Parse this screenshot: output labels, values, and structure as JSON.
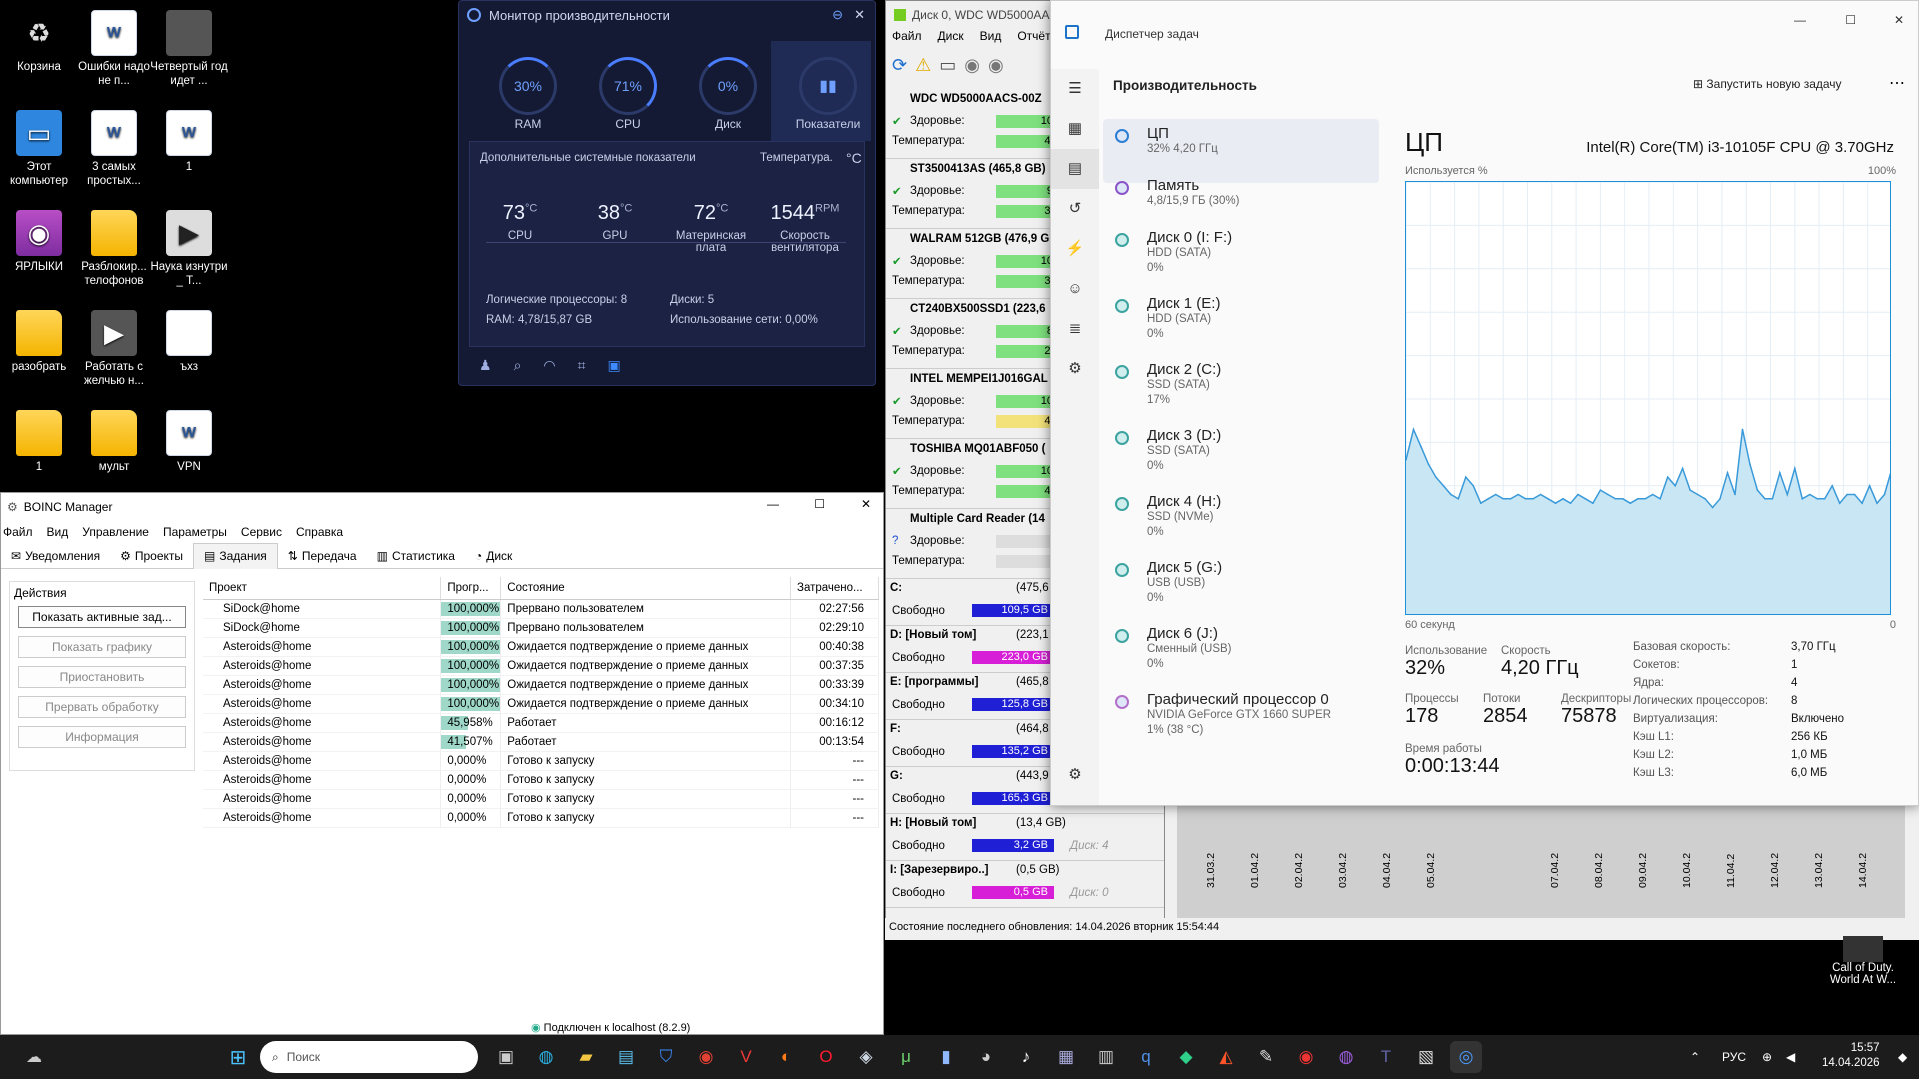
{
  "desktop": {
    "icons": [
      "Корзина",
      "Ошибки надо не п...",
      "Четвертый год идет ...",
      "Этот компьютер",
      "3 самых простых...",
      "1",
      "ЯРЛЫКИ",
      "Разблокир... телофонов",
      "Наука изнутри _ Т...",
      "разобрать",
      "Работать с желчью н...",
      "ъхз",
      "1",
      "мульт",
      "VPN"
    ],
    "callofduty": "Call of Duty. World At W..."
  },
  "perfmon": {
    "title": "Монитор производительности",
    "gauges": [
      {
        "value": "30%",
        "label": "RAM"
      },
      {
        "value": "71%",
        "label": "CPU"
      },
      {
        "value": "0%",
        "label": "Диск"
      },
      {
        "value": "",
        "label": "Показатели"
      }
    ],
    "panel_title": "Дополнительные системные показатели",
    "temp_label": "Температура.",
    "temp_unit": "°C",
    "metrics": [
      {
        "v": "73",
        "u": "°C",
        "l": "CPU"
      },
      {
        "v": "38",
        "u": "°C",
        "l": "GPU"
      },
      {
        "v": "72",
        "u": "°C",
        "l": "Материнская плата"
      },
      {
        "v": "1544",
        "u": "RPM",
        "l": "Скорость вентилятора"
      }
    ],
    "info": [
      "Логические процессоры: 8",
      "Диски: 5",
      "RAM: 4,78/15,87 GB",
      "Использование сети: 0,00%"
    ]
  },
  "diskwin": {
    "title": "Диск 0, WDC WD5000AA",
    "menu": [
      "Файл",
      "Диск",
      "Вид",
      "Отчёт"
    ],
    "health_label": "Здоровье:",
    "temp_label": "Температура:",
    "disks": [
      {
        "name": "WDC WD5000AACS-00Z",
        "health": "100 %",
        "temp": "40 °C"
      },
      {
        "name": "ST3500413AS (465,8 GB)",
        "health": "97 %",
        "temp": "39 °C"
      },
      {
        "name": "WALRAM 512GB (476,9 G",
        "health": "100 %",
        "temp": "30 °C"
      },
      {
        "name": "CT240BX500SSD1 (223,6",
        "health": "86 %",
        "temp": "28 °C"
      },
      {
        "name": "INTEL MEMPEI1J016GAL",
        "health": "100 %",
        "temp": "49 °C"
      },
      {
        "name": "TOSHIBA MQ01ABF050 (",
        "health": "100 %",
        "temp": "41 °C"
      },
      {
        "name": "Multiple Card Reader (14",
        "health": "?",
        "temp": "?"
      }
    ],
    "free_label": "Свободно",
    "vols": [
      {
        "n": "C:",
        "sz": "(475,6",
        "f": "109,5 GB",
        "c": "#1f1fd6"
      },
      {
        "n": "D: [Новый том]",
        "sz": "(223,1",
        "f": "223,0 GB",
        "c": "#d61fd6"
      },
      {
        "n": "E: [программы]",
        "sz": "(465,8",
        "f": "125,8 GB",
        "c": "#1f1fd6"
      },
      {
        "n": "F:",
        "sz": "(464,8",
        "f": "135,2 GB",
        "c": "#1f1fd6"
      },
      {
        "n": "G:",
        "sz": "(443,9",
        "f": "165,3 GB",
        "c": "#1f1fd6",
        "d": "Диск: 5"
      },
      {
        "n": "H: [Новый том]",
        "sz": "(13,4 GB)",
        "f": "3,2 GB",
        "c": "#1f1fd6",
        "d": "Диск: 4"
      },
      {
        "n": "I: [Зарезервиро..]",
        "sz": "(0,5 GB)",
        "f": "0,5 GB",
        "c": "#d61fd6",
        "d": "Диск: 0"
      }
    ],
    "status": "Состояние последнего обновления: 14.04.2026 вторник 15:54:44",
    "dates": [
      "31.03.2",
      "01.04.2",
      "02.04.2",
      "03.04.2",
      "04.04.2",
      "05.04.2",
      "07.04.2",
      "08.04.2",
      "09.04.2",
      "10.04.2",
      "11.04.2",
      "12.04.2",
      "13.04.2",
      "14.04.2"
    ]
  },
  "taskmgr": {
    "title": "Диспетчер задач",
    "section": "Производительность",
    "new_task": "Запустить новую задачу",
    "devices": [
      {
        "n": "ЦП",
        "s1": "32% 4,20 ГГц",
        "s2": "",
        "sel": true,
        "c": "#2a7fd4"
      },
      {
        "n": "Память",
        "s1": "4,8/15,9 ГБ (30%)",
        "s2": "",
        "c": "#8a55c8"
      },
      {
        "n": "Диск 0 (I: F:)",
        "s1": "HDD (SATA)",
        "s2": "0%"
      },
      {
        "n": "Диск 1 (E:)",
        "s1": "HDD (SATA)",
        "s2": "0%"
      },
      {
        "n": "Диск 2 (C:)",
        "s1": "SSD (SATA)",
        "s2": "17%"
      },
      {
        "n": "Диск 3 (D:)",
        "s1": "SSD (SATA)",
        "s2": "0%"
      },
      {
        "n": "Диск 4 (H:)",
        "s1": "SSD (NVMe)",
        "s2": "0%"
      },
      {
        "n": "Диск 5 (G:)",
        "s1": "USB (USB)",
        "s2": "0%"
      },
      {
        "n": "Диск 6 (J:)",
        "s1": "Сменный (USB)",
        "s2": "0%"
      },
      {
        "n": "Графический процессор 0",
        "s1": "NVIDIA GeForce GTX 1660 SUPER",
        "s2": "1% (38 °C)",
        "c": "#b36fc9"
      }
    ],
    "cpu_title": "ЦП",
    "cpu_model": "Intel(R) Core(TM) i3-10105F CPU @ 3.70GHz",
    "usage_pct": "Используется %",
    "pct100": "100%",
    "sec60": "60 секунд",
    "zero": "0",
    "stats": [
      {
        "l": "Использование",
        "v": "32%"
      },
      {
        "l": "Скорость",
        "v": "4,20 ГГц"
      },
      {
        "l": "Процессы",
        "v": "178"
      },
      {
        "l": "Потоки",
        "v": "2854"
      },
      {
        "l": "Дескрипторы",
        "v": "75878"
      },
      {
        "l": "Время работы",
        "v": "0:00:13:44"
      }
    ],
    "specs": [
      [
        "Базовая скорость:",
        "3,70 ГГц"
      ],
      [
        "Сокетов:",
        "1"
      ],
      [
        "Ядра:",
        "4"
      ],
      [
        "Логических процессоров:",
        "8"
      ],
      [
        "Виртуализация:",
        "Включено"
      ],
      [
        "Кэш L1:",
        "256 КБ"
      ],
      [
        "Кэш L2:",
        "1,0 МБ"
      ],
      [
        "Кэш L3:",
        "6,0 МБ"
      ]
    ]
  },
  "chart_data": {
    "type": "area",
    "title": "ЦП",
    "ylabel": "Используется %",
    "ylim": [
      0,
      100
    ],
    "values": [
      36,
      43,
      39,
      35,
      32,
      30,
      28,
      27,
      32,
      30,
      26,
      27,
      28,
      27,
      27,
      28,
      27,
      27,
      28,
      27,
      26,
      27,
      26,
      28,
      27,
      26,
      29,
      28,
      27,
      27,
      26,
      27,
      27,
      28,
      27,
      32,
      30,
      34,
      29,
      28,
      27,
      25,
      27,
      33,
      28,
      43,
      35,
      29,
      27,
      27,
      33,
      28,
      34,
      27,
      28,
      27,
      27,
      30,
      26,
      28,
      28,
      26,
      30,
      26,
      28,
      34
    ]
  },
  "boinc": {
    "title": "BOINC Manager",
    "menu": [
      "Файл",
      "Вид",
      "Управление",
      "Параметры",
      "Сервис",
      "Справка"
    ],
    "tabs": [
      "Уведомления",
      "Проекты",
      "Задания",
      "Передача",
      "Статистика",
      "Диск"
    ],
    "actions_title": "Действия",
    "buttons": [
      "Показать активные зад...",
      "Показать графику",
      "Приостановить",
      "Прервать обработку",
      "Информация"
    ],
    "cols": [
      "Проект",
      "Прогр...",
      "Состояние",
      "Затрачено..."
    ],
    "rows": [
      [
        "SiDock@home",
        "100,000%",
        "Прервано пользователем",
        "02:27:56"
      ],
      [
        "SiDock@home",
        "100,000%",
        "Прервано пользователем",
        "02:29:10"
      ],
      [
        "Asteroids@home",
        "100,000%",
        "Ожидается подтверждение о приеме данных",
        "00:40:38"
      ],
      [
        "Asteroids@home",
        "100,000%",
        "Ожидается подтверждение о приеме данных",
        "00:37:35"
      ],
      [
        "Asteroids@home",
        "100,000%",
        "Ожидается подтверждение о приеме данных",
        "00:33:39"
      ],
      [
        "Asteroids@home",
        "100,000%",
        "Ожидается подтверждение о приеме данных",
        "00:34:10"
      ],
      [
        "Asteroids@home",
        "45,958%",
        "Работает",
        "00:16:12"
      ],
      [
        "Asteroids@home",
        "41,507%",
        "Работает",
        "00:13:54"
      ],
      [
        "Asteroids@home",
        "0,000%",
        "Готово к запуску",
        "---"
      ],
      [
        "Asteroids@home",
        "0,000%",
        "Готово к запуску",
        "---"
      ],
      [
        "Asteroids@home",
        "0,000%",
        "Готово к запуску",
        "---"
      ],
      [
        "Asteroids@home",
        "0,000%",
        "Готово к запуску",
        "---"
      ]
    ],
    "progress": [
      1,
      1,
      1,
      1,
      1,
      1,
      0.45958,
      0.41507,
      0,
      0,
      0,
      0
    ],
    "status": "Подключен к localhost (8.2.9)"
  },
  "taskbar": {
    "search": "Поиск",
    "lang": "РУС",
    "time": "15:57",
    "date": "14.04.2026"
  }
}
